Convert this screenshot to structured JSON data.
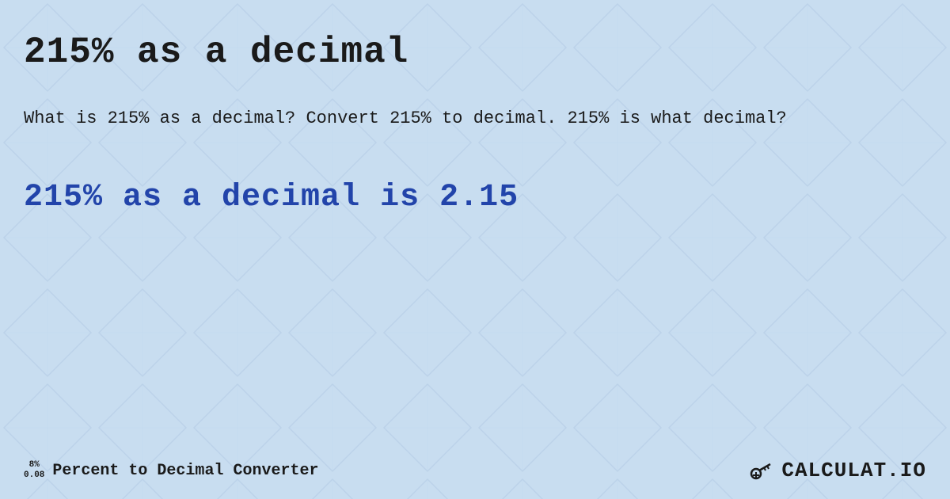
{
  "page": {
    "background_color": "#c8ddf0",
    "main_title": "215% as a decimal",
    "description": "What is 215% as a decimal? Convert 215% to decimal. 215% is what decimal?",
    "result_text": "215% as a decimal is 2.15",
    "footer": {
      "percent_top": "8%",
      "percent_bottom": "0.08",
      "label": "Percent to Decimal Converter",
      "logo_text": "CALCULAT.IO"
    }
  }
}
